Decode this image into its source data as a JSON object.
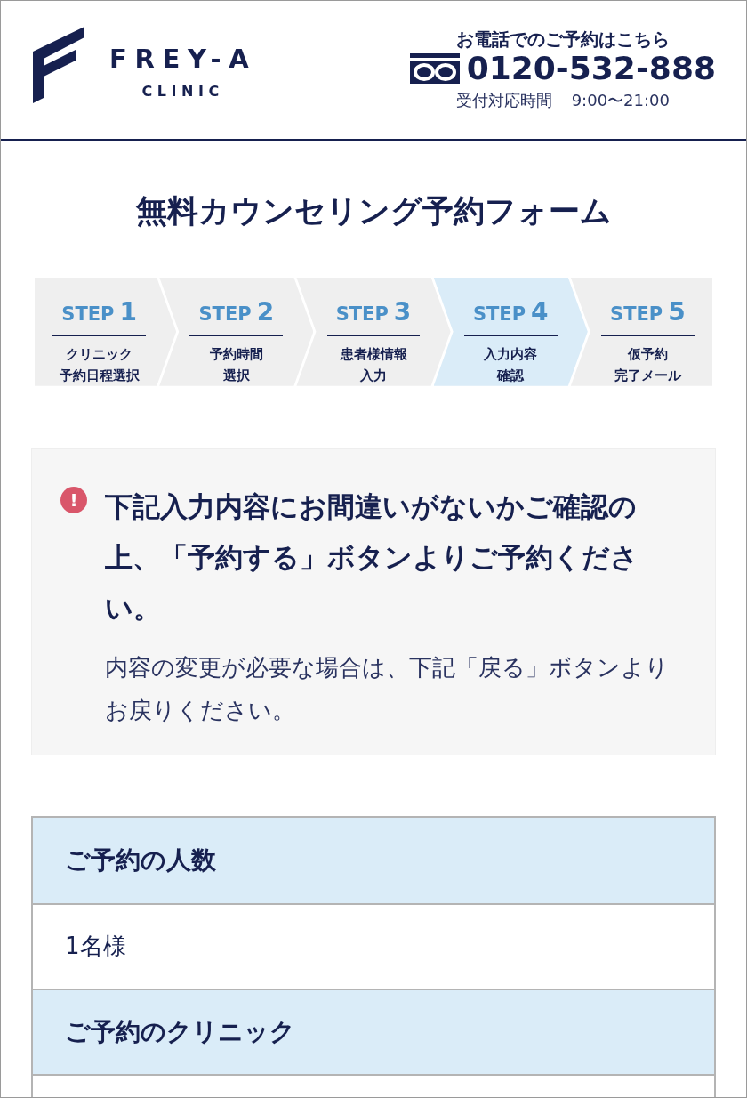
{
  "header": {
    "logo": {
      "name": "FREY-A",
      "sub": "CLINIC"
    },
    "phone": {
      "caption": "お電話でのご予約はこちら",
      "number": "0120-532-888",
      "hours_label": "受付対応時間",
      "hours": "9:00〜21:00"
    }
  },
  "title": "無料カウンセリング予約フォーム",
  "steps": [
    {
      "label": "STEP",
      "number": "1",
      "lines": [
        "クリニック",
        "予約日程選択"
      ],
      "selected": false
    },
    {
      "label": "STEP",
      "number": "2",
      "lines": [
        "予約時間",
        "選択"
      ],
      "selected": false
    },
    {
      "label": "STEP",
      "number": "3",
      "lines": [
        "患者様情報",
        "入力"
      ],
      "selected": false
    },
    {
      "label": "STEP",
      "number": "4",
      "lines": [
        "入力内容",
        "確認"
      ],
      "selected": true
    },
    {
      "label": "STEP",
      "number": "5",
      "lines": [
        "仮予約",
        "完了メール"
      ],
      "selected": false
    }
  ],
  "notice": {
    "icon": "!",
    "heading": "下記入力内容にお間違いがないかご確認の上、「予約する」ボタンよりご予約ください。",
    "text": "内容の変更が必要な場合は、下記「戻る」ボタンよりお戻りください。"
  },
  "table": [
    {
      "kind": "header",
      "text": "ご予約の人数"
    },
    {
      "kind": "value",
      "text": "1名様"
    },
    {
      "kind": "header",
      "text": "ご予約のクリニック"
    }
  ]
}
